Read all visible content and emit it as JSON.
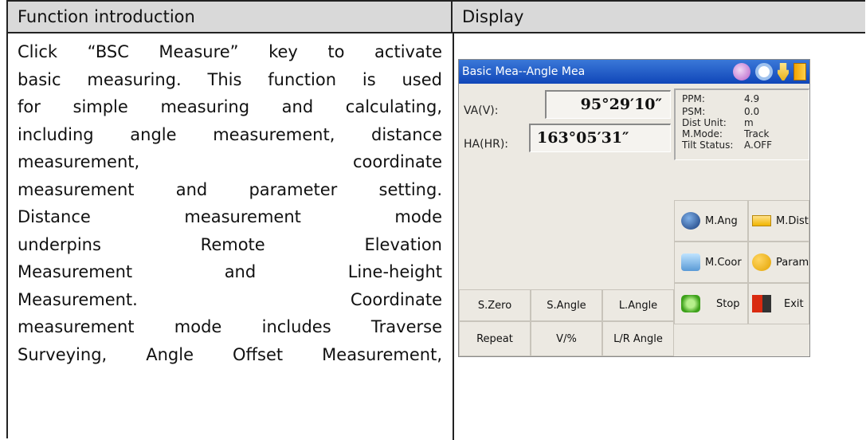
{
  "table": {
    "header_left": "Function introduction",
    "header_right": "Display",
    "intro_lines": [
      "Click “BSC Measure” key to activate",
      "basic measuring. This function is used",
      "for simple measuring and calculating,",
      "including angle measurement, distance",
      "measurement, coordinate",
      "measurement and parameter setting.",
      "Distance measurement mode",
      "underpins Remote Elevation",
      "Measurement and Line-height",
      "Measurement. Coordinate",
      "measurement mode includes Traverse",
      "Surveying, Angle Offset Measurement,"
    ]
  },
  "screen": {
    "title": "Basic Mea--Angle Mea",
    "status_icons": [
      "stop-icon",
      "gear-icon",
      "plug-icon",
      "battery-icon"
    ],
    "va_label": "VA(V):",
    "va_value": "95°29′10″",
    "ha_label": "HA(HR):",
    "ha_value": "163°05′31″",
    "info": [
      {
        "label": "PPM:",
        "value": "4.9"
      },
      {
        "label": "PSM:",
        "value": "0.0"
      },
      {
        "label": "Dist Unit:",
        "value": "m"
      },
      {
        "label": "M.Mode:",
        "value": "Track"
      },
      {
        "label": "Tilt Status:",
        "value": "A.OFF"
      }
    ],
    "buttons": {
      "m_ang": "M.Ang",
      "m_dist": "M.Dist",
      "m_coor": "M.Coor",
      "param": "Param",
      "stop": "Stop",
      "exit": "Exit",
      "s_zero": "S.Zero",
      "s_angle": "S.Angle",
      "l_angle": "L.Angle",
      "repeat": "Repeat",
      "v_percent": "V/%",
      "lr_angle": "L/R Angle"
    }
  }
}
